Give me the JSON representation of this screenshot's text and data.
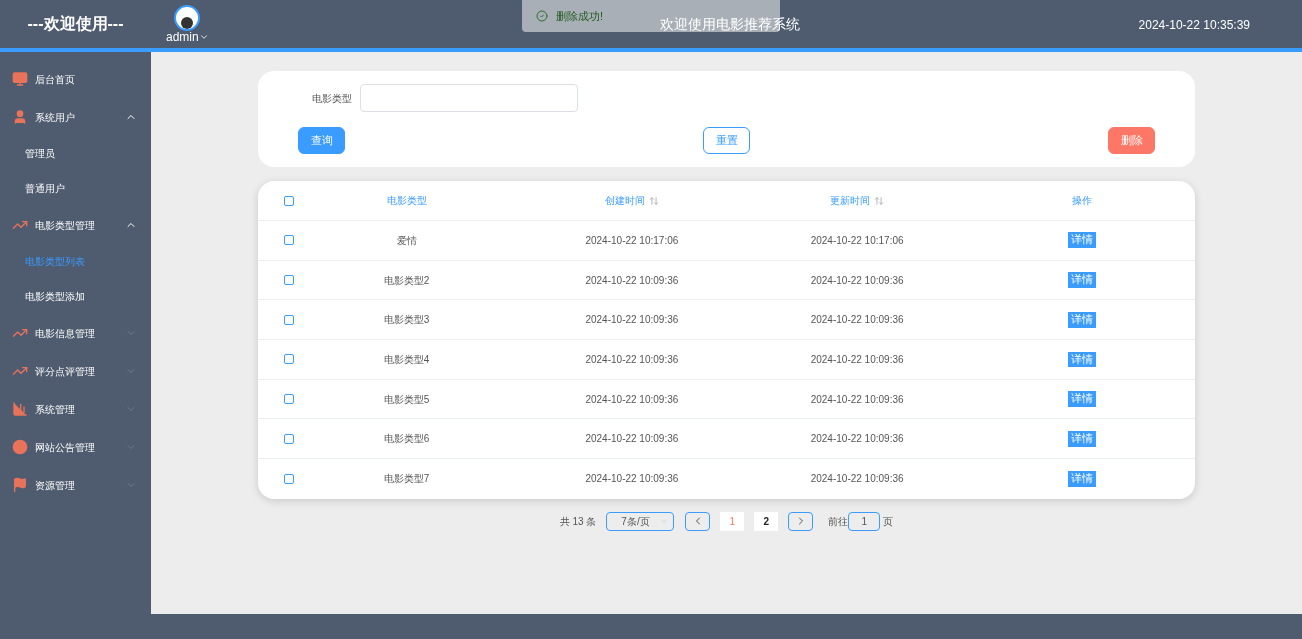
{
  "header": {
    "brand": "---欢迎使用---",
    "user": "admin",
    "title": "欢迎使用电影推荐系统",
    "datetime": "2024-10-22 10:35:39"
  },
  "toast": {
    "message": "删除成功!"
  },
  "sidebar": {
    "items": [
      {
        "label": "后台首页"
      },
      {
        "label": "系统用户",
        "expanded": true,
        "children": [
          {
            "label": "管理员",
            "selected": false
          },
          {
            "label": "普通用户",
            "selected": false
          }
        ]
      },
      {
        "label": "电影类型管理",
        "expanded": true,
        "children": [
          {
            "label": "电影类型列表",
            "selected": true
          },
          {
            "label": "电影类型添加",
            "selected": false
          }
        ]
      },
      {
        "label": "电影信息管理",
        "expanded": false
      },
      {
        "label": "评分点评管理",
        "expanded": false
      },
      {
        "label": "系统管理",
        "expanded": false
      },
      {
        "label": "网站公告管理",
        "expanded": false
      },
      {
        "label": "资源管理",
        "expanded": false
      }
    ]
  },
  "search": {
    "label": "电影类型",
    "buttons": [
      {
        "label": "查询",
        "kind": "primary"
      },
      {
        "label": "重置",
        "kind": "outline"
      },
      {
        "label": "删除",
        "kind": "danger"
      }
    ]
  },
  "table": {
    "all_checked": false,
    "columns": [
      {
        "label": "电影类型",
        "sortable": false
      },
      {
        "label": "创建时间",
        "sortable": true
      },
      {
        "label": "更新时间",
        "sortable": true
      },
      {
        "label": "操作",
        "sortable": false
      }
    ],
    "rows": [
      {
        "type": "爱情",
        "created": "2024-10-22 10:17:06",
        "updated": "2024-10-22 10:17:06",
        "action": "详情",
        "checked": false
      },
      {
        "type": "电影类型2",
        "created": "2024-10-22 10:09:36",
        "updated": "2024-10-22 10:09:36",
        "action": "详情",
        "checked": false
      },
      {
        "type": "电影类型3",
        "created": "2024-10-22 10:09:36",
        "updated": "2024-10-22 10:09:36",
        "action": "详情",
        "checked": false
      },
      {
        "type": "电影类型4",
        "created": "2024-10-22 10:09:36",
        "updated": "2024-10-22 10:09:36",
        "action": "详情",
        "checked": false
      },
      {
        "type": "电影类型5",
        "created": "2024-10-22 10:09:36",
        "updated": "2024-10-22 10:09:36",
        "action": "详情",
        "checked": false
      },
      {
        "type": "电影类型6",
        "created": "2024-10-22 10:09:36",
        "updated": "2024-10-22 10:09:36",
        "action": "详情",
        "checked": false
      },
      {
        "type": "电影类型7",
        "created": "2024-10-22 10:09:36",
        "updated": "2024-10-22 10:09:36",
        "action": "详情",
        "checked": false
      }
    ]
  },
  "pagination": {
    "total": "共 13 条",
    "page_size": "7条/页",
    "pages": [
      {
        "label": "1",
        "selected": true
      },
      {
        "label": "2",
        "selected": false
      }
    ],
    "goto_label": "前往",
    "goto_value": "1",
    "goto_suffix": "页"
  }
}
